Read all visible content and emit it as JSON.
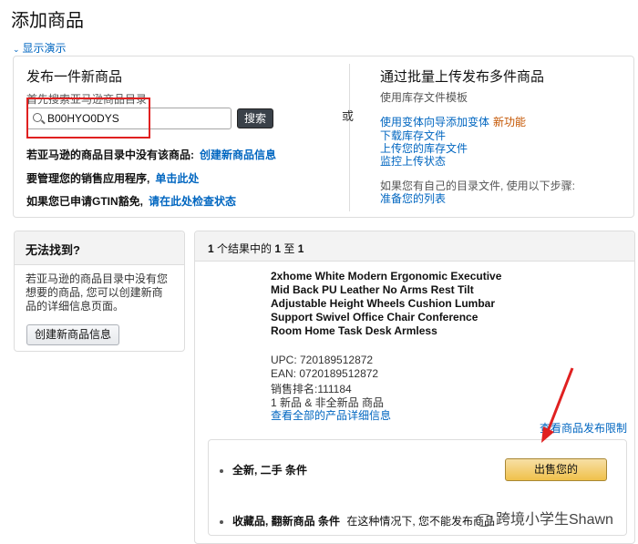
{
  "page": {
    "title": "添加商品",
    "show_demo": "显示演示"
  },
  "single": {
    "title": "发布一件新商品",
    "search_hint": "首先搜索亚马逊商品目录",
    "search_value": "B00HYO0DYS",
    "search_button": "搜索",
    "rows": [
      {
        "text": "若亚马逊的商品目录中没有该商品:",
        "link": "创建新商品信息"
      },
      {
        "text": "要管理您的销售应用程序,",
        "link": "单击此处"
      },
      {
        "text": "如果您已申请GTIN豁免,",
        "link": "请在此处检查状态"
      }
    ]
  },
  "or_label": "或",
  "bulk": {
    "title": "通过批量上传发布多件商品",
    "subtitle": "使用库存文件模板",
    "links": [
      "使用变体向导添加变体",
      "下载库存文件",
      "上传您的库存文件",
      "监控上传状态"
    ],
    "new_feature": "新功能",
    "note": "如果您有自己的目录文件, 使用以下步骤:",
    "prepare_link": "准备您的列表"
  },
  "not_found": {
    "title": "无法找到?",
    "body": "若亚马逊的商品目录中没有您想要的商品, 您可以创建新商品的详细信息页面。",
    "button": "创建新商品信息"
  },
  "results": {
    "header_prefix": "个结果中的",
    "header_total": "1",
    "header_from": "1",
    "header_to": "1",
    "header_mid": "至",
    "product_title": "2xhome White Modern Ergonomic Executive Mid Back PU Leather No Arms Rest Tilt Adjustable Height Wheels Cushion Lumbar Support Swivel Office Chair Conference Room Home Task Desk Armless",
    "upc": "UPC: 720189512872",
    "ean": "EAN: 0720189512872",
    "rank": "销售排名:111184",
    "offers": "1 新品 & 非全新品 商品",
    "details_link": "查看全部的产品详细信息",
    "restrict_link": "查看商品发布限制",
    "conditions": [
      {
        "label": "全新, 二手 条件",
        "extra": ""
      },
      {
        "label": "收藏品, 翻新商品 条件",
        "extra": "在这种情况下, 您不能发布商品"
      }
    ],
    "sell_button": "出售您的"
  },
  "watermark": "跨境小学生Shawn"
}
